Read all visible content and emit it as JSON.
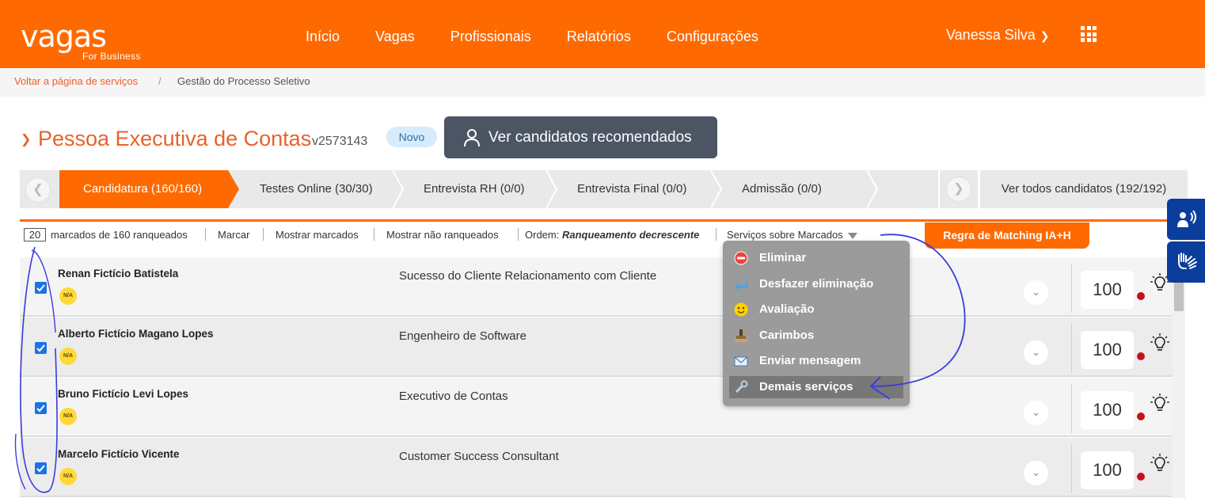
{
  "brand": {
    "logo_text": "vagas",
    "logo_sub": "For Business"
  },
  "nav": {
    "items": [
      "Início",
      "Vagas",
      "Profissionais",
      "Relatórios",
      "Configurações"
    ],
    "user_name": "Vanessa Silva"
  },
  "breadcrumb": {
    "link": "Voltar a página de serviços",
    "separator": "/",
    "current": "Gestão do Processo Seletivo"
  },
  "job": {
    "title": "Pessoa Executiva de Contas",
    "code": "v2573143",
    "badge": "Novo",
    "recommended_button": "Ver candidatos recomendados"
  },
  "stages": {
    "items": [
      {
        "label": "Candidatura (160/160)",
        "active": true
      },
      {
        "label": "Testes Online (30/30)",
        "active": false
      },
      {
        "label": "Entrevista RH (0/0)",
        "active": false
      },
      {
        "label": "Entrevista Final (0/0)",
        "active": false
      },
      {
        "label": "Admissão (0/0)",
        "active": false
      }
    ],
    "all_candidates": "Ver todos candidatos (192/192)"
  },
  "toolbar": {
    "marked_count": "20",
    "marked_text": "marcados de 160 ranqueados",
    "mark": "Marcar",
    "show_marked": "Mostrar marcados",
    "show_unranked": "Mostrar não ranqueados",
    "order_label": "Ordem:",
    "order_value": "Ranqueamento decrescente",
    "services": "Serviços sobre Marcados",
    "matching_button": "Regra de Matching IA+H"
  },
  "dropdown": {
    "items": [
      {
        "label": "Eliminar",
        "icon": "minus-circle-icon"
      },
      {
        "label": "Desfazer eliminação",
        "icon": "undo-arrow-icon"
      },
      {
        "label": "Avaliação",
        "icon": "smiley-icon"
      },
      {
        "label": "Carimbos",
        "icon": "stamp-icon"
      },
      {
        "label": "Enviar mensagem",
        "icon": "envelope-icon"
      },
      {
        "label": "Demais serviços",
        "icon": "wrench-icon",
        "highlighted": true
      }
    ]
  },
  "candidates": [
    {
      "name": "Renan Fictício Batistela",
      "role": "Sucesso do Cliente Relacionamento com Cliente",
      "score": "100",
      "badge": "N/A"
    },
    {
      "name": "Alberto Fictício Magano Lopes",
      "role": "Engenheiro de Software",
      "score": "100",
      "badge": "N/A"
    },
    {
      "name": "Bruno Fictício Levi Lopes",
      "role": "Executivo de Contas",
      "score": "100",
      "badge": "N/A"
    },
    {
      "name": "Marcelo Fictício Vicente",
      "role": "Customer Success Consultant",
      "score": "100",
      "badge": "N/A"
    }
  ],
  "colors": {
    "brand_orange": "#ff6a00",
    "accessibility_blue": "#0a3d9c",
    "annotation_blue": "#3b3bdc"
  }
}
